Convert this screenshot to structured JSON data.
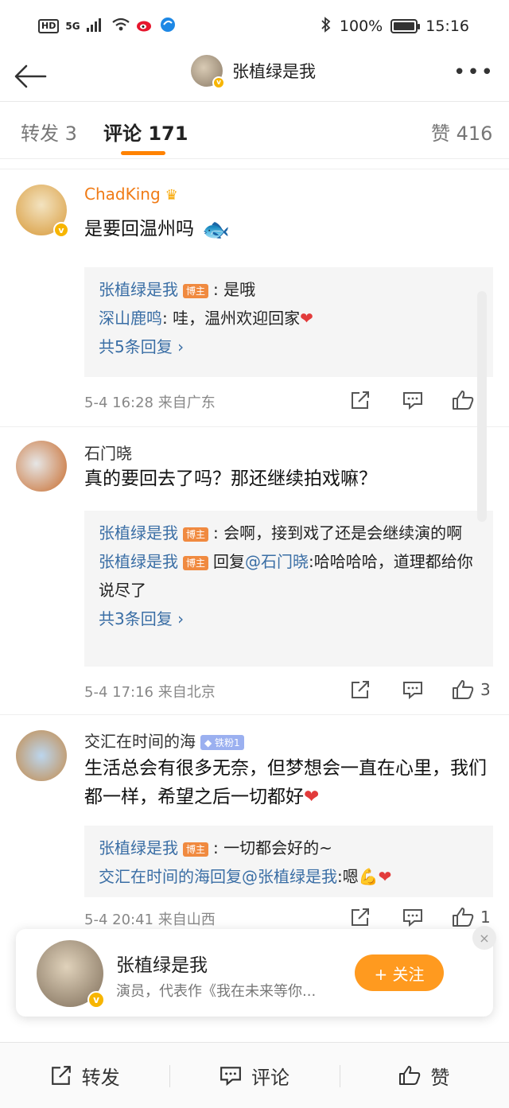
{
  "statusbar": {
    "left_tags": [
      "HD",
      "5G"
    ],
    "battery": "100%",
    "time": "15:16"
  },
  "header": {
    "title": "张植绿是我",
    "more": "•••"
  },
  "tabs": {
    "repost": "转发 3",
    "comments": "评论 171",
    "likes": "赞 416"
  },
  "comments": [
    {
      "name": "ChadKing",
      "text": "是要回温州吗",
      "replies": [
        {
          "name": "张植绿是我",
          "badge": "博主",
          "text": ": 是哦"
        },
        {
          "name": "深山鹿鸣",
          "text": ": 哇，温州欢迎回家"
        }
      ],
      "more": "共5条回复 ›",
      "time": "5-4 16:28  来自广东",
      "likes": ""
    },
    {
      "name": "石门晓",
      "text": "真的要回去了吗？那还继续拍戏嘛？",
      "replies": [
        {
          "name": "张植绿是我",
          "badge": "博主",
          "text": ": 会啊，接到戏了还是会继续演的啊"
        },
        {
          "name": "张植绿是我",
          "badge": "博主",
          "text": "回复",
          "mention": "@石门晓",
          "text2": ":哈哈哈哈，道理都给你说尽了"
        }
      ],
      "more": "共3条回复 ›",
      "time": "5-4 17:16  来自北京",
      "likes": "3"
    },
    {
      "name": "交汇在时间的海",
      "fan_badge": "铁粉1",
      "text": "生活总会有很多无奈，但梦想会一直在心里，我们都一样，希望之后一切都好",
      "replies": [
        {
          "name": "张植绿是我",
          "badge": "博主",
          "text": ": 一切都会好的~"
        },
        {
          "name": "交汇在时间的海",
          "text": "回复",
          "mention": "@张植绿是我",
          "text2": ":嗯💪"
        }
      ],
      "time": "5-4 20:41  来自山西",
      "likes": "1"
    }
  ],
  "follow_card": {
    "name": "张植绿是我",
    "desc": "演员，代表作《我在未来等你...",
    "button": "+ 关注",
    "close": "×"
  },
  "bottombar": {
    "repost": "转发",
    "comment": "评论",
    "like": "赞"
  }
}
